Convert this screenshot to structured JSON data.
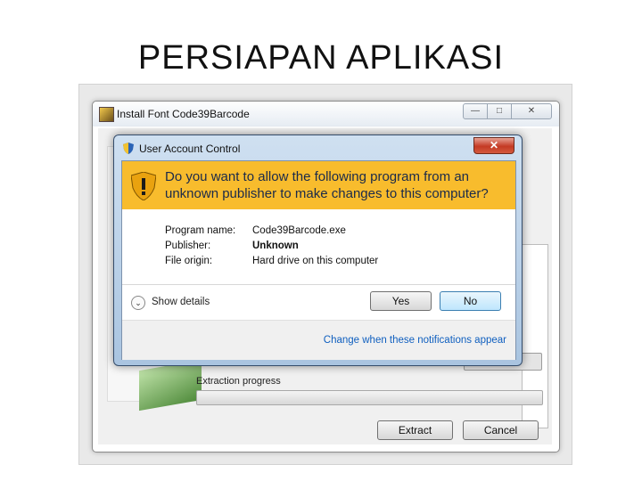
{
  "slide": {
    "title": "PERSIAPAN APLIKASI"
  },
  "install_window": {
    "title": "Install Font Code39Barcode",
    "window_controls": {
      "minimize": "—",
      "maximize": "□",
      "close": "✕"
    },
    "progress_label": "Extraction progress",
    "progress": 0,
    "buttons": {
      "extract": "Extract",
      "cancel": "Cancel"
    }
  },
  "uac": {
    "title": "User Account Control",
    "close": "✕",
    "question": "Do you want to allow the following program from an unknown publisher to make changes to this computer?",
    "details": [
      {
        "label": "Program name:",
        "value": "Code39Barcode.exe"
      },
      {
        "label": "Publisher:",
        "value": "Unknown"
      },
      {
        "label": "File origin:",
        "value": "Hard drive on this computer"
      }
    ],
    "show_details": "Show details",
    "chevron": "⌄",
    "buttons": {
      "yes": "Yes",
      "no": "No"
    },
    "notifications_link": "Change when these notifications appear",
    "colors": {
      "banner": "#f8bc2d",
      "link": "#0f5fbf"
    }
  }
}
